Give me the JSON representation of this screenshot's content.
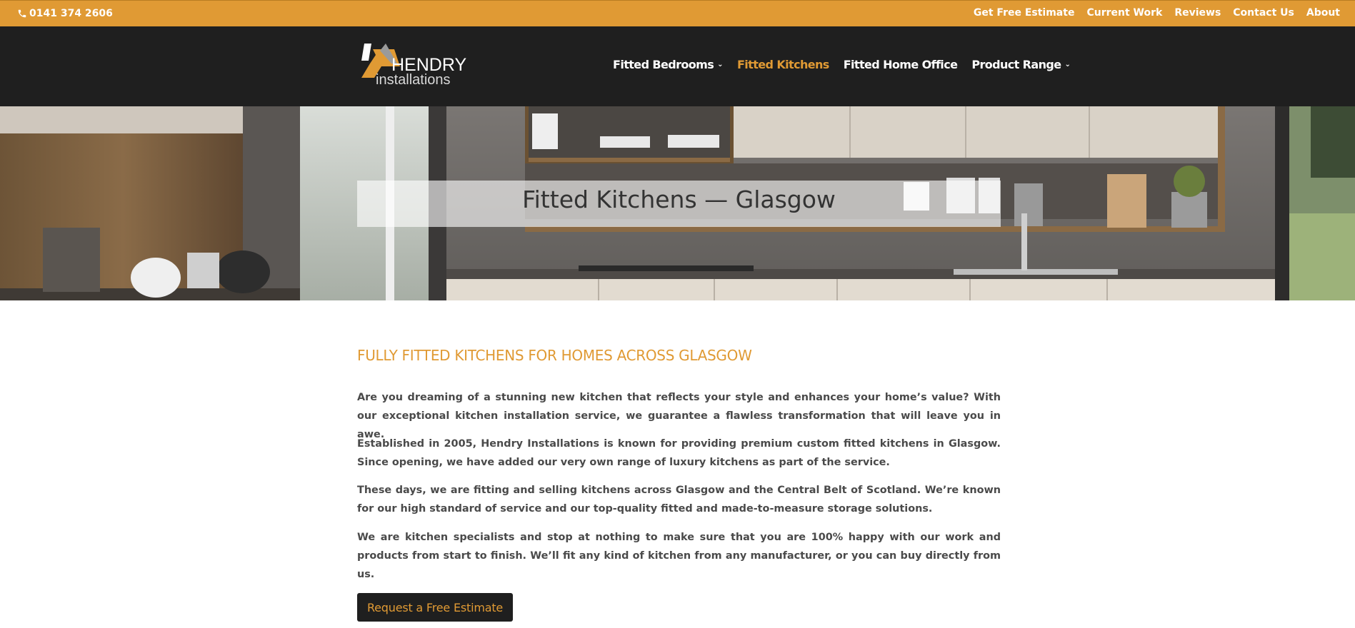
{
  "topbar": {
    "phone": "0141 374 2606",
    "links": [
      "Get Free Estimate",
      "Current Work",
      "Reviews",
      "Contact Us",
      "About"
    ]
  },
  "header": {
    "logo_word": "HENDRY",
    "logo_sub": "installations",
    "nav": [
      {
        "label": "Fitted Bedrooms",
        "has_dropdown": true,
        "active": false
      },
      {
        "label": "Fitted Kitchens",
        "has_dropdown": false,
        "active": true
      },
      {
        "label": "Fitted Home Office",
        "has_dropdown": false,
        "active": false
      },
      {
        "label": "Product Range",
        "has_dropdown": true,
        "active": false
      }
    ]
  },
  "hero": {
    "title": "Fitted Kitchens — Glasgow"
  },
  "main": {
    "heading": "FULLY FITTED KITCHENS FOR HOMES ACROSS GLASGOW",
    "paragraphs": [
      "Are you dreaming of a stunning new kitchen that reflects your style and enhances your home’s value? With our exceptional kitchen installation service, we guarantee a flawless transformation that will leave you in awe.",
      "Established in 2005, Hendry Installations is known for providing premium custom fitted kitchens in Glasgow. Since opening, we have added our very own range of luxury kitchens as part of the service.",
      "These days, we are fitting and selling kitchens across Glasgow and the Central Belt of Scotland. We’re known for our high standard of service and our top-quality fitted and made-to-measure storage solutions.",
      "We are kitchen specialists and stop at nothing to make sure that you are 100% happy with our work and products from start to finish. We’ll fit any kind of kitchen from any manufacturer, or you can buy directly from us."
    ],
    "cta": "Request a Free Estimate"
  },
  "colors": {
    "accent": "#e09a34",
    "header_bg": "#1f1f1f",
    "text": "#4a4a4a"
  },
  "icons": {
    "phone": "phone-icon",
    "dropdown": "chevron-down-icon"
  }
}
